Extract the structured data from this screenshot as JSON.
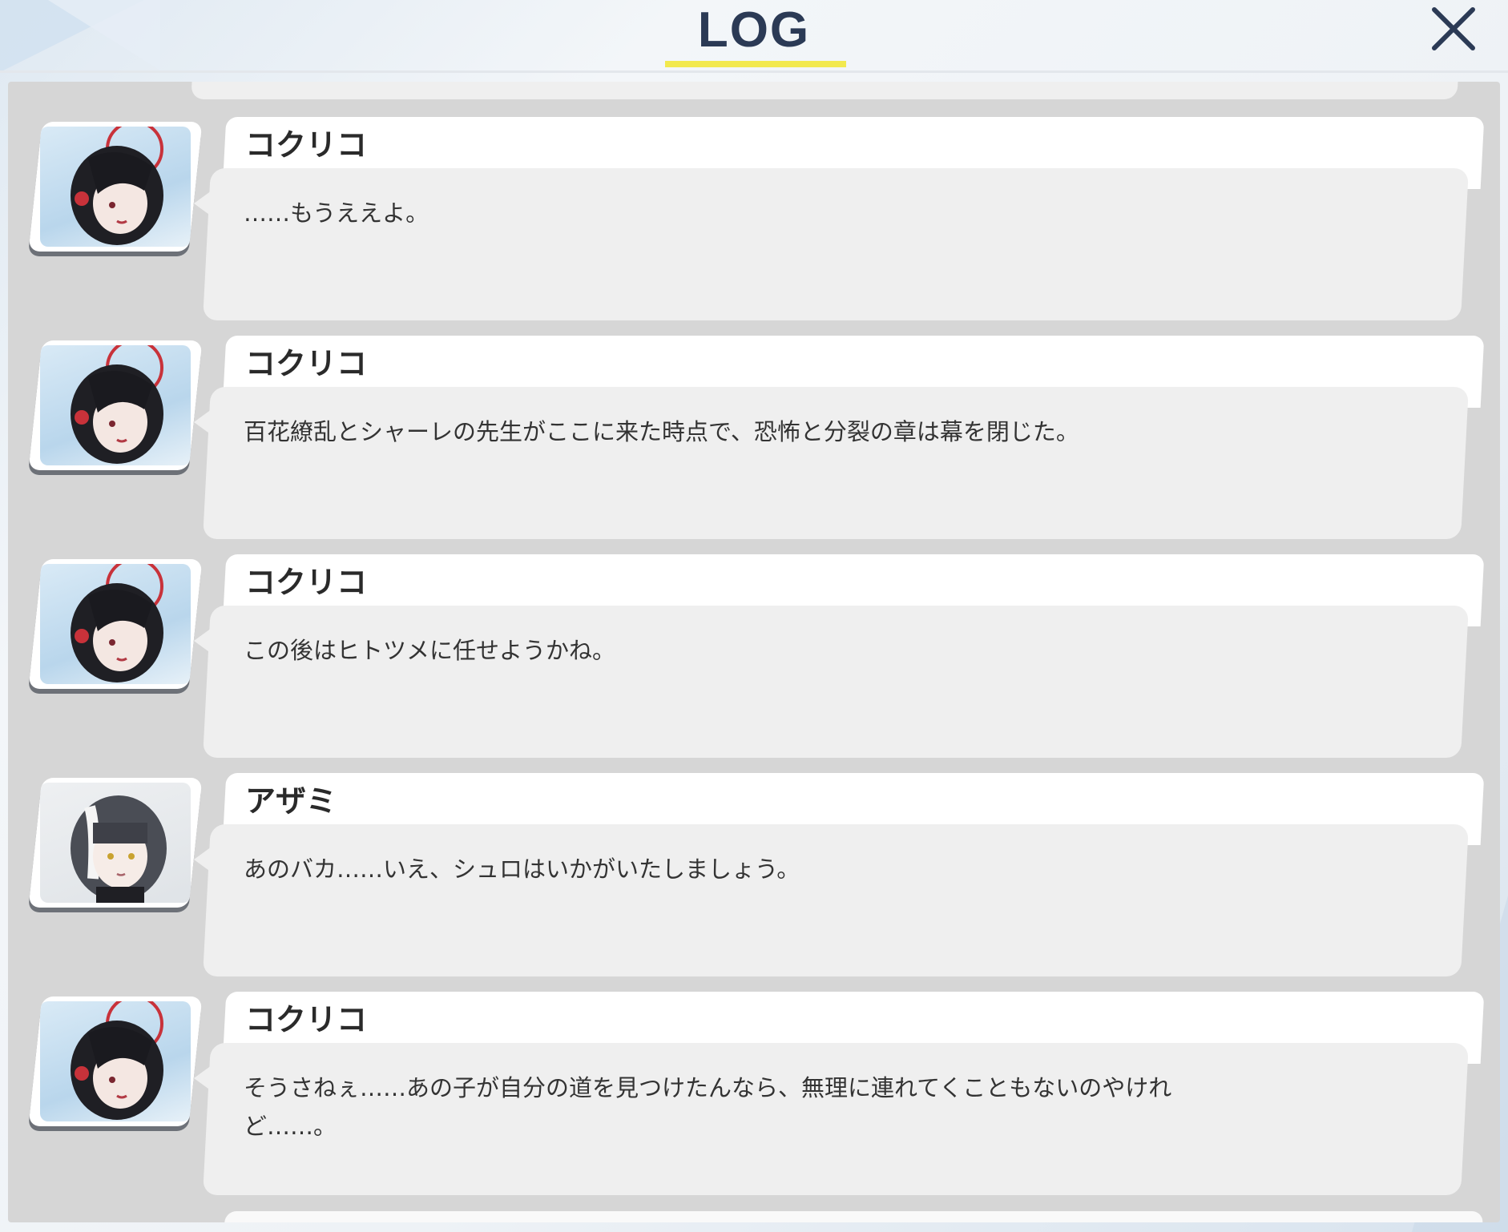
{
  "header": {
    "title": "LOG",
    "close_icon": "close-icon"
  },
  "colors": {
    "accent_underline": "#f2e94e",
    "title": "#2b3a55",
    "panel": "#d6d6d6",
    "bubble": "#efefef",
    "name_bar": "#ffffff"
  },
  "entries": [
    {
      "speaker": "コクリコ",
      "text": "……もうええよ。",
      "avatar": "kokuriko-portrait"
    },
    {
      "speaker": "コクリコ",
      "text": "百花繚乱とシャーレの先生がここに来た時点で、恐怖と分裂の章は幕を閉じた。",
      "avatar": "kokuriko-portrait"
    },
    {
      "speaker": "コクリコ",
      "text": "この後はヒトツメに任せようかね。",
      "avatar": "kokuriko-portrait"
    },
    {
      "speaker": "アザミ",
      "text": "あのバカ……いえ、シュロはいかがいたしましょう。",
      "avatar": "azami-portrait"
    },
    {
      "speaker": "コクリコ",
      "text": "そうさねぇ……あの子が自分の道を見つけたんなら、無理に連れてくこともないのやけれ\nど……。",
      "avatar": "kokuriko-portrait"
    }
  ]
}
